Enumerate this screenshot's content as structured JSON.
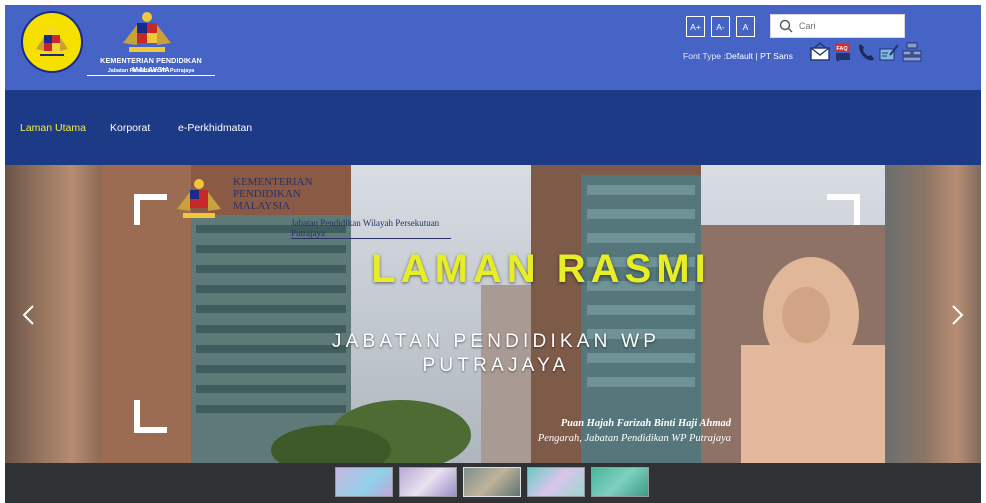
{
  "header": {
    "ministry_name": "KEMENTERIAN PENDIDIKAN MALAYSIA",
    "department_name": "Jabatan Pendidikan WP Putrajaya",
    "font_size_buttons": [
      "A+",
      "A-",
      "A"
    ],
    "search_placeholder": "Cari",
    "font_type_label": "Font Type :",
    "font_type_options": "Default | PT Sans",
    "quick_icons": [
      "email-icon",
      "faq-icon",
      "phone-icon",
      "feedback-icon",
      "sitemap-icon"
    ]
  },
  "nav": {
    "items": [
      {
        "label": "Laman Utama",
        "active": true
      },
      {
        "label": "Korporat",
        "active": false
      },
      {
        "label": "e-Perkhidmatan",
        "active": false
      }
    ]
  },
  "slide": {
    "logo_text_line1": "KEMENTERIAN",
    "logo_text_line2": "PENDIDIKAN",
    "logo_text_line3": "MALAYSIA",
    "logo_subtext": "Jabatan Pendidikan Wilayah Persekutuan Putrajaya",
    "title": "LAMAN RASMI",
    "subtitle_line1": "JABATAN PENDIDIKAN WP",
    "subtitle_line2": "PUTRAJAYA",
    "caption_name": "Puan Hajah Farizah Binti Haji Ahmad",
    "caption_role": "Pengarah, Jabatan Pendidikan WP Putrajaya"
  },
  "slider": {
    "thumbnail_count": 5
  },
  "colors": {
    "header_bg": "#4664c6",
    "nav_bg": "#1d3a86",
    "nav_active": "#f6ef3e",
    "slide_title": "#e7ee26"
  }
}
